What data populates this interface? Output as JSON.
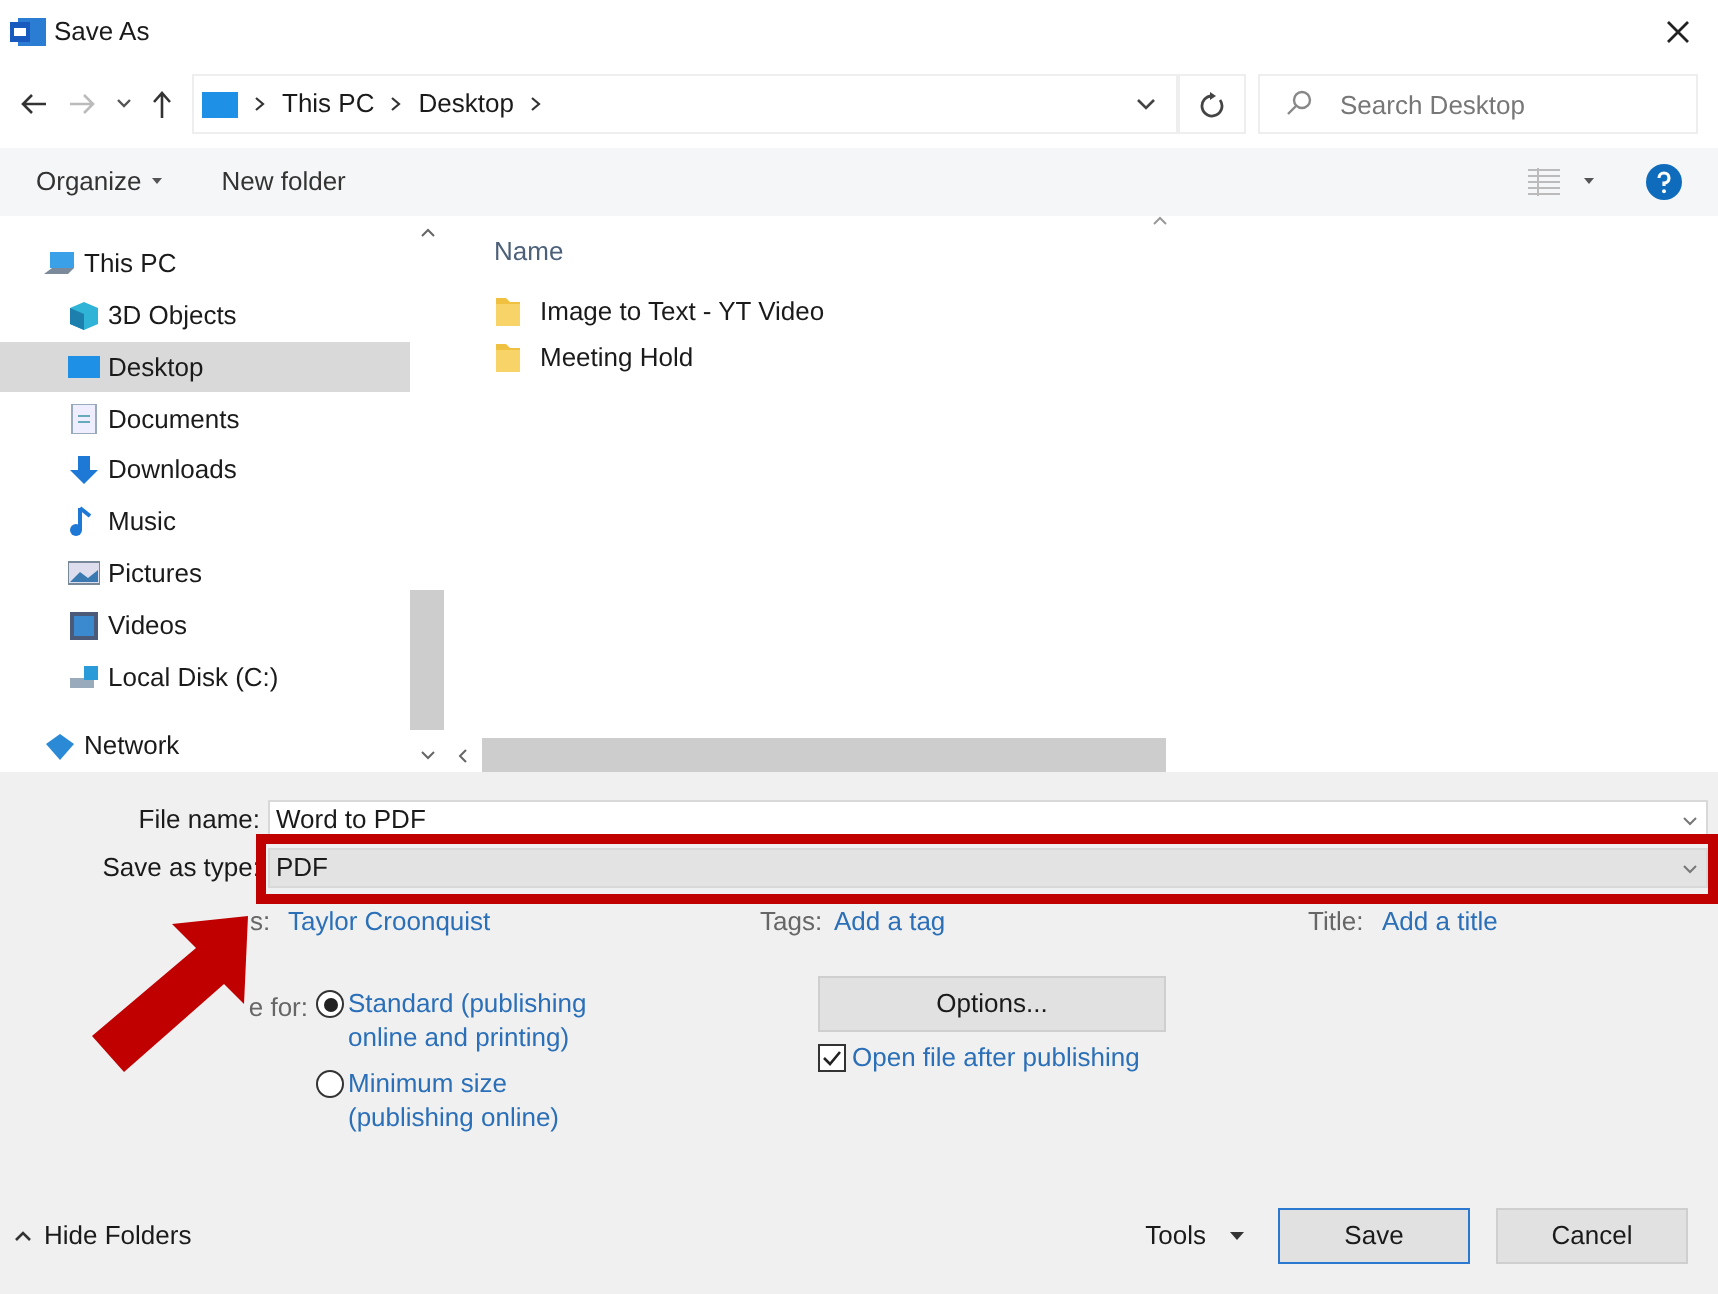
{
  "window": {
    "title": "Save As"
  },
  "address": {
    "path": [
      "This PC",
      "Desktop"
    ],
    "search_placeholder": "Search Desktop"
  },
  "toolbar": {
    "organize": "Organize",
    "new_folder": "New folder"
  },
  "nav": [
    {
      "label": "This PC",
      "kind": "pc",
      "selected": false,
      "children": [
        {
          "label": "3D Objects",
          "kind": "cube",
          "selected": false
        },
        {
          "label": "Desktop",
          "kind": "desktop",
          "selected": true
        },
        {
          "label": "Documents",
          "kind": "doc",
          "selected": false
        },
        {
          "label": "Downloads",
          "kind": "download",
          "selected": false
        },
        {
          "label": "Music",
          "kind": "music",
          "selected": false
        },
        {
          "label": "Pictures",
          "kind": "pictures",
          "selected": false
        },
        {
          "label": "Videos",
          "kind": "videos",
          "selected": false
        },
        {
          "label": "Local Disk (C:)",
          "kind": "disk",
          "selected": false
        }
      ]
    },
    {
      "label": "Network",
      "kind": "network",
      "selected": false
    }
  ],
  "file_list": {
    "column": "Name",
    "items": [
      "Image to Text - YT Video",
      "Meeting Hold"
    ]
  },
  "form": {
    "file_name_label": "File name:",
    "file_name": "Word to PDF",
    "type_label": "Save as type:",
    "type": "PDF"
  },
  "meta": [
    {
      "label": "s:",
      "value": "Taylor Croonquist"
    },
    {
      "label": "Tags:",
      "value": "Add a tag"
    },
    {
      "label": "Title:",
      "value": "Add a title"
    }
  ],
  "optimize": {
    "label": "e for:",
    "options": [
      {
        "label": "Standard (publishing online and printing)",
        "selected": true
      },
      {
        "label": "Minimum size (publishing online)",
        "selected": false
      }
    ]
  },
  "options_button": "Options...",
  "open_after": {
    "label": "Open file after publishing",
    "checked": true
  },
  "footer": {
    "hide_folders": "Hide Folders",
    "tools": "Tools",
    "save": "Save",
    "cancel": "Cancel"
  },
  "annotation": {
    "highlight": true,
    "arrow": true
  }
}
